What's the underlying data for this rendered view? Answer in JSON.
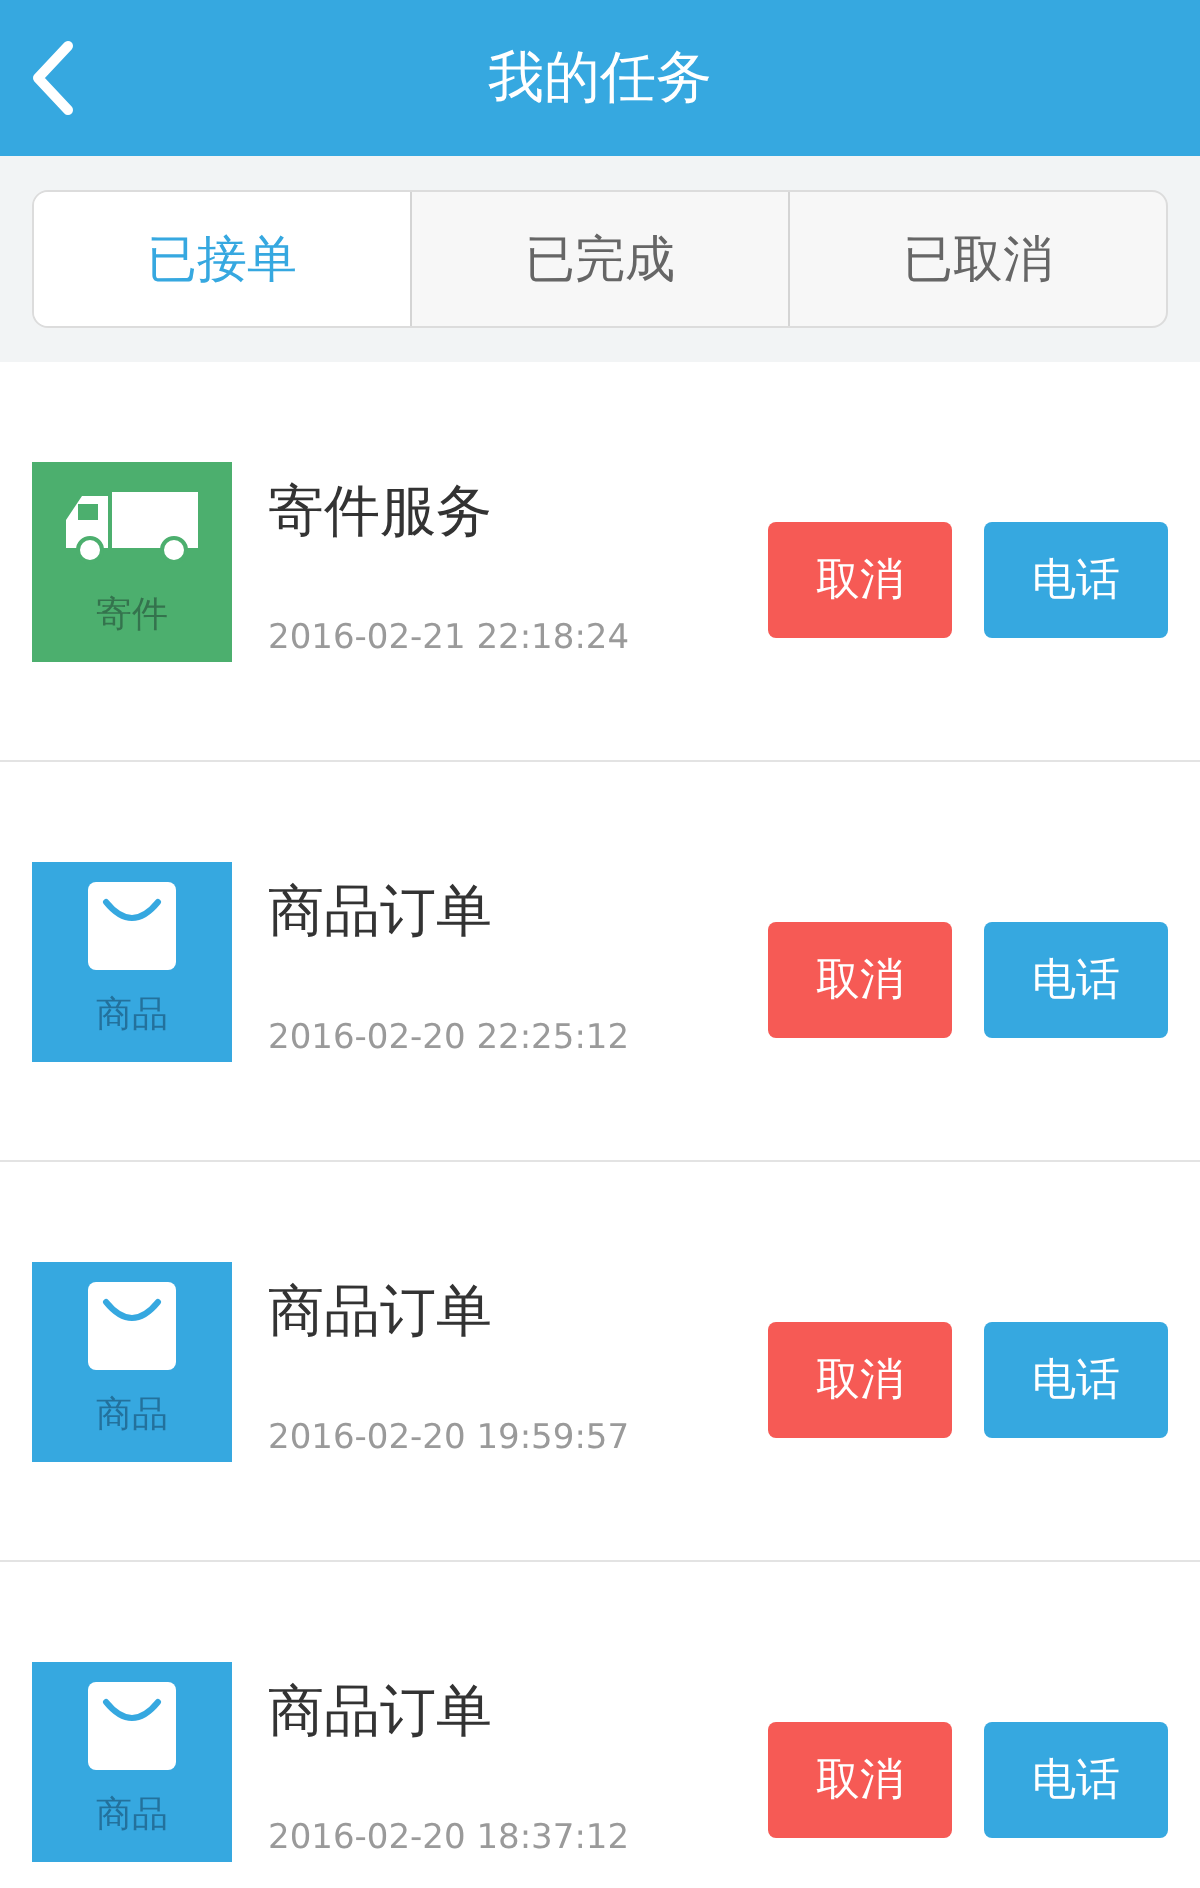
{
  "header": {
    "title": "我的任务"
  },
  "tabs": [
    {
      "label": "已接单",
      "selected": true
    },
    {
      "label": "已完成",
      "selected": false
    },
    {
      "label": "已取消",
      "selected": false
    }
  ],
  "tasks": [
    {
      "kind": "shipping",
      "badge": "寄件",
      "title": "寄件服务",
      "time": "2016-02-21 22:18:24",
      "buttons": [
        "取消",
        "电话"
      ]
    },
    {
      "kind": "goods",
      "badge": "商品",
      "title": "商品订单",
      "time": "2016-02-20 22:25:12",
      "buttons": [
        "取消",
        "电话"
      ]
    },
    {
      "kind": "goods",
      "badge": "商品",
      "title": "商品订单",
      "time": "2016-02-20 19:59:57",
      "buttons": [
        "取消",
        "电话"
      ]
    },
    {
      "kind": "goods",
      "badge": "商品",
      "title": "商品订单",
      "time": "2016-02-20 18:37:12",
      "buttons": [
        "取消",
        "电话"
      ]
    }
  ]
}
